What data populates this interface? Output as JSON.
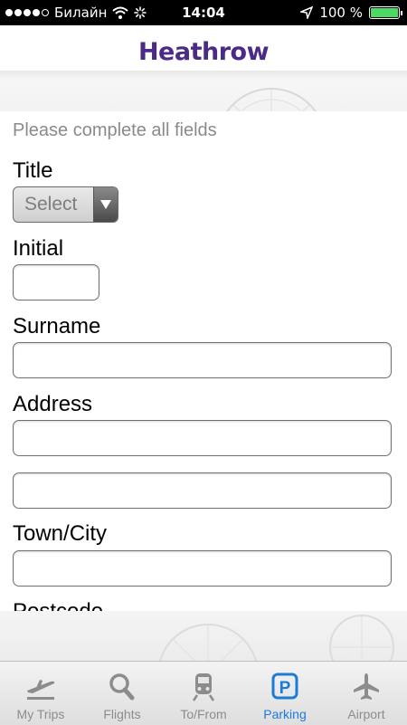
{
  "status_bar": {
    "carrier": "Билайн",
    "time": "14:04",
    "battery_percent": "100 %",
    "signal_bars": 4
  },
  "header": {
    "logo_text": "Heathrow",
    "logo_color": "#4b2b86"
  },
  "form": {
    "hint": "Please complete all fields",
    "title_label": "Title",
    "title_select_value": "Select",
    "initial_label": "Initial",
    "initial_value": "",
    "surname_label": "Surname",
    "surname_value": "",
    "address_label": "Address",
    "address_line1_value": "",
    "address_line2_value": "",
    "town_label": "Town/City",
    "town_value": "",
    "postcode_label": "Postcode"
  },
  "tabbar": {
    "active_color": "#1d7bd8",
    "tabs": [
      {
        "label": "My Trips",
        "icon": "plane-departing-icon",
        "active": false
      },
      {
        "label": "Flights",
        "icon": "search-icon",
        "active": false
      },
      {
        "label": "To/From",
        "icon": "train-icon",
        "active": false
      },
      {
        "label": "Parking",
        "icon": "parking-icon",
        "active": true
      },
      {
        "label": "Airport",
        "icon": "airplane-icon",
        "active": false
      }
    ]
  }
}
